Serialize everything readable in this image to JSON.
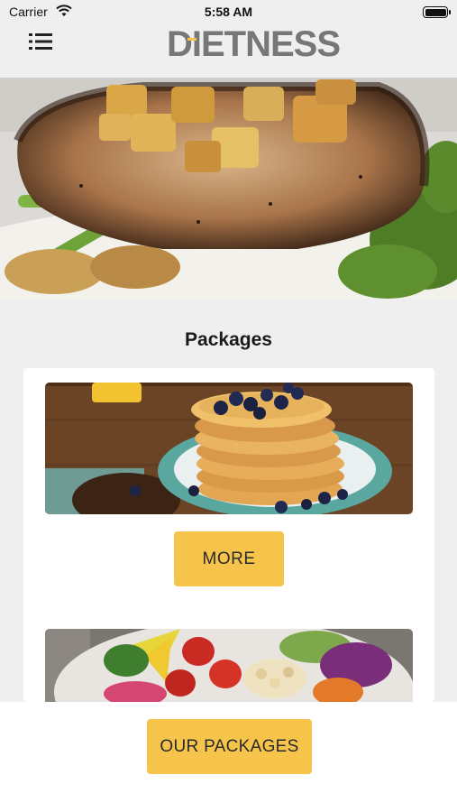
{
  "status_bar": {
    "carrier": "Carrier",
    "time": "5:58 AM"
  },
  "header": {
    "menu_icon": "list-menu-icon",
    "logo_text": "DIETNESS"
  },
  "hero": {
    "image": "grilled-pork-chop-with-apples-and-broccolini"
  },
  "packages": {
    "title": "Packages",
    "items": [
      {
        "image": "blueberry-pancake-stack",
        "button_label": "MORE"
      },
      {
        "image": "fresh-salad-bowl"
      }
    ]
  },
  "bottom": {
    "button_label": "OUR PACKAGES"
  },
  "colors": {
    "accent": "#f7c44b",
    "background": "#efefef",
    "card": "#ffffff",
    "logo": "#777777"
  }
}
